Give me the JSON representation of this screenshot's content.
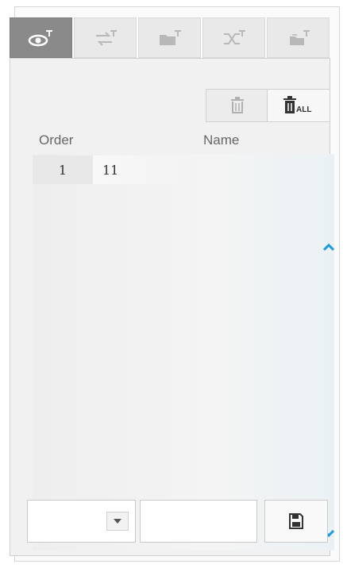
{
  "tabs": [
    {
      "icon": "eye-pin-icon",
      "active": true
    },
    {
      "icon": "route-pin-icon",
      "active": false
    },
    {
      "icon": "folder-pin-icon",
      "active": false
    },
    {
      "icon": "shuffle-pin-icon",
      "active": false
    },
    {
      "icon": "folder-stack-pin-icon",
      "active": false
    }
  ],
  "toolbar": {
    "delete_icon": "trash-icon",
    "delete_all_icon": "trash-all-icon",
    "delete_all_text": "ALL"
  },
  "columns": {
    "order": "Order",
    "name": "Name"
  },
  "rows": [
    {
      "order": "1",
      "name": "11"
    }
  ],
  "bottom": {
    "select_value": "",
    "name_value": "",
    "save_icon": "save-disk-icon"
  },
  "colors": {
    "active_tab": "#8a8a8a",
    "accent_arrow": "#1a9ad6"
  }
}
